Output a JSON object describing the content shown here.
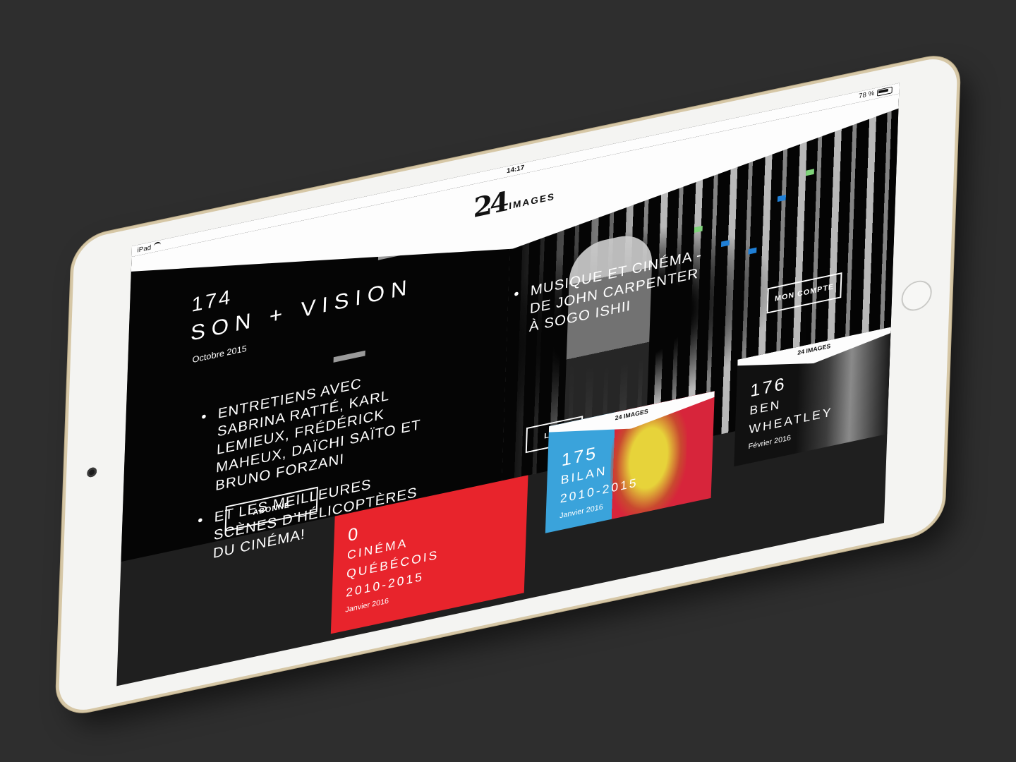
{
  "status_bar": {
    "device": "iPad",
    "time": "14:17",
    "battery": "78 %"
  },
  "logo": {
    "number": "24",
    "word": "IMAGES"
  },
  "mini_logo": "24 IMAGES",
  "hero": {
    "issue_number": "174",
    "title": "SON + VISION",
    "date": "Octobre 2015",
    "bullets_left": [
      "Entretiens avec Sabrina Ratté, Karl Lemieux, Frédérick Maheux, Daïchi Saïto et Bruno Forzani",
      "Et les meilleures scènes d’hélicoptères du cinéma!"
    ],
    "bullets_right": [
      "Musique et cinéma - de John Carpenter à Sogo Ishii"
    ],
    "buttons": {
      "subscribe": "ABONNÉ",
      "read": "LIRE",
      "account": "MON COMPTE"
    }
  },
  "tiles": [
    {
      "number": "0",
      "title_1": "CINÉMA",
      "title_2": "QUÉBÉCOIS",
      "title_3": "2010-2015",
      "date": "Janvier 2016",
      "color": "#e8242c"
    },
    {
      "number": "175",
      "title_1": "BILAN",
      "title_2": "2010-2015",
      "date": "Janvier 2016"
    },
    {
      "number": "176",
      "title_1": "BEN",
      "title_2": "WHEATLEY",
      "date": "Février 2016"
    }
  ],
  "colors": {
    "background": "#2e2e2e",
    "screen_black": "#050505",
    "accent_red": "#e8242c",
    "accent_blue": "#3aa3db",
    "pixel_green": "#7fd37a",
    "pixel_blue": "#1f7fd6"
  }
}
